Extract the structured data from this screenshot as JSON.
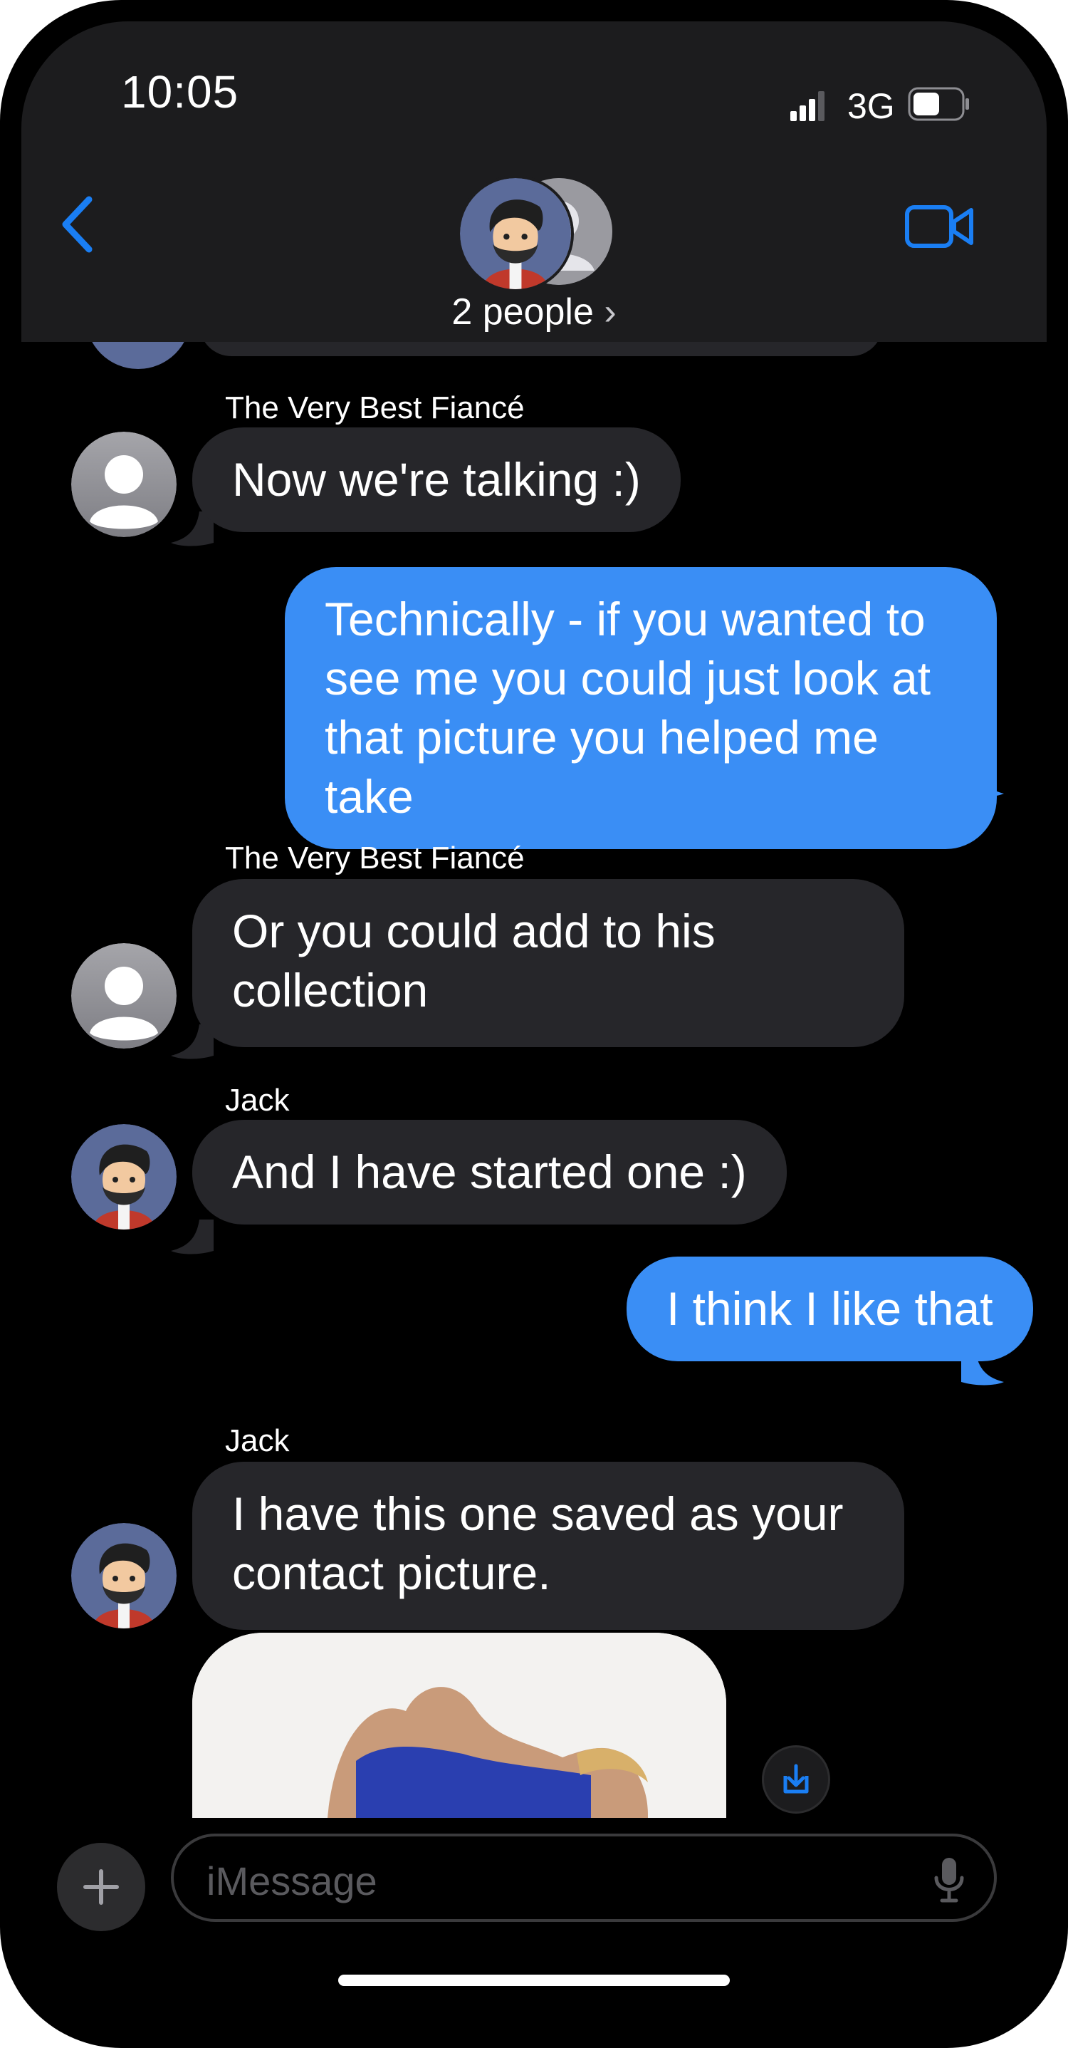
{
  "status": {
    "time": "10:05",
    "network": "3G"
  },
  "header": {
    "title": "2 people",
    "chevron": "›"
  },
  "colors": {
    "imessage_blue": "#3a8ef5",
    "incoming_gray": "#26262a",
    "accent": "#1a7ef3"
  },
  "messages": [
    {
      "sender": "The Very Best Fiancé",
      "text": "Now we're talking :)",
      "direction": "incoming",
      "avatar": "default-person-icon"
    },
    {
      "text": "Technically - if you wanted to see me you could just look at that picture you helped me take",
      "direction": "outgoing"
    },
    {
      "sender": "The Very Best Fiancé",
      "text": "Or you could add to his collection",
      "direction": "incoming",
      "avatar": "default-person-icon"
    },
    {
      "sender": "Jack",
      "text": "And I have started one :)",
      "direction": "incoming",
      "avatar": "cartoon-man-avatar"
    },
    {
      "text": "I think I like that",
      "direction": "outgoing"
    },
    {
      "sender": "Jack",
      "text": "I have this one saved as your contact picture.",
      "direction": "incoming",
      "avatar": "cartoon-man-avatar",
      "attachment": "photo"
    }
  ],
  "composer": {
    "placeholder": "iMessage"
  }
}
